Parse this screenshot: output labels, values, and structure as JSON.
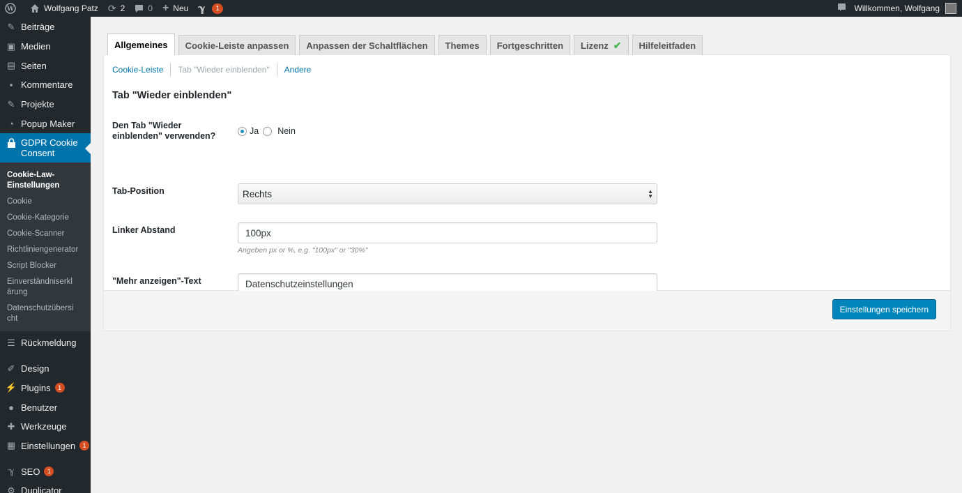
{
  "adminbar": {
    "site_name": "Wolfgang Patz",
    "updates_count": "2",
    "comments_count": "0",
    "new_label": "Neu",
    "seo_count": "1",
    "greeting": "Willkommen, Wolfgang"
  },
  "sidebar": {
    "items_top": [
      {
        "label": "Beiträge",
        "icon": "pin-icon"
      },
      {
        "label": "Medien",
        "icon": "media-icon"
      },
      {
        "label": "Seiten",
        "icon": "page-icon"
      },
      {
        "label": "Kommentare",
        "icon": "comment-icon"
      },
      {
        "label": "Projekte",
        "icon": "pin-icon"
      },
      {
        "label": "Popup Maker",
        "icon": "popup-icon"
      }
    ],
    "current": {
      "label": "GDPR Cookie Consent",
      "icon": "lock-icon"
    },
    "submenu": [
      "Cookie-Law-Einstellungen",
      "Cookie",
      "Cookie-Kategorie",
      "Cookie-Scanner",
      "Richtliniengenerator",
      "Script Blocker",
      "Einverständniserklärung",
      "Datenschutzübersicht"
    ],
    "items_bottom": [
      {
        "label": "Rückmeldung",
        "icon": "feedback-icon",
        "badge": ""
      },
      {
        "label": "Design",
        "icon": "brush-icon",
        "badge": ""
      },
      {
        "label": "Plugins",
        "icon": "plugin-icon",
        "badge": "1"
      },
      {
        "label": "Benutzer",
        "icon": "user-icon",
        "badge": ""
      },
      {
        "label": "Werkzeuge",
        "icon": "wrench-icon",
        "badge": ""
      },
      {
        "label": "Einstellungen",
        "icon": "settings-icon",
        "badge": "1"
      },
      {
        "label": "SEO",
        "icon": "yoast-icon",
        "badge": "1"
      },
      {
        "label": "Duplicator",
        "icon": "duplicator-icon",
        "badge": ""
      }
    ]
  },
  "tabs": [
    {
      "label": "Allgemeines",
      "active": true
    },
    {
      "label": "Cookie-Leiste anpassen"
    },
    {
      "label": "Anpassen der Schaltflächen"
    },
    {
      "label": "Themes"
    },
    {
      "label": "Fortgeschritten"
    },
    {
      "label": "Lizenz",
      "check": true
    },
    {
      "label": "Hilfeleitfaden"
    }
  ],
  "subnav": {
    "cookie_bar": "Cookie-Leiste",
    "show_again_tab": "Tab \"Wieder einblenden\"",
    "other": "Andere"
  },
  "form": {
    "section_title": "Tab \"Wieder einblenden\"",
    "use_tab_label": "Den Tab \"Wieder einblenden\" verwenden?",
    "yes": "Ja",
    "no": "Nein",
    "yes_selected": true,
    "position_label": "Tab-Position",
    "position_value": "Rechts",
    "margin_label": "Linker Abstand",
    "margin_value": "100px",
    "margin_hint": "Angeben px or %, e.g. \"100px\" or \"30%\"",
    "more_text_label": "\"Mehr anzeigen\"-Text",
    "more_text_value": "Datenschutzeinstellungen"
  },
  "footer": {
    "save_label": "Einstellungen speichern"
  },
  "colors": {
    "admin_dark": "#23282d",
    "accent_blue": "#0073aa",
    "button_blue": "#0085ba",
    "badge_orange": "#d54e21",
    "check_green": "#46b450"
  }
}
